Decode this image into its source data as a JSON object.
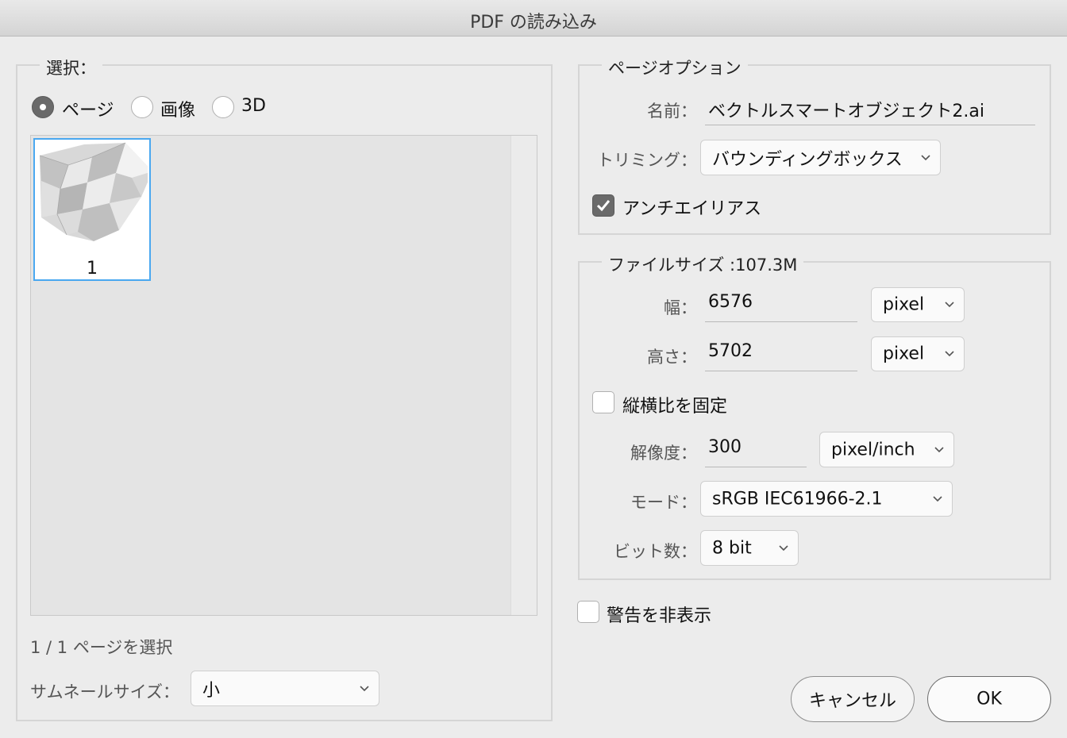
{
  "window": {
    "title": "PDF の読み込み"
  },
  "selection": {
    "legend": "選択：",
    "options": [
      "ページ",
      "画像",
      "3D"
    ],
    "selected": "ページ",
    "thumbnail_number": "1",
    "status": "1 / 1 ページを選択",
    "thumb_size_label": "サムネールサイズ：",
    "thumb_size_value": "小"
  },
  "page_options": {
    "legend": "ページオプション",
    "name_label": "名前：",
    "name_value": "ベクトルスマートオブジェクト2.ai",
    "crop_label": "トリミング：",
    "crop_value": "バウンディングボックス",
    "antialias_label": "アンチエイリアス",
    "antialias_checked": true
  },
  "image_size": {
    "legend": "ファイルサイズ :107.3M",
    "width_label": "幅：",
    "width_value": "6576",
    "width_unit": "pixel",
    "height_label": "高さ：",
    "height_value": "5702",
    "height_unit": "pixel",
    "constrain_label": "縦横比を固定",
    "constrain_checked": false,
    "resolution_label": "解像度：",
    "resolution_value": "300",
    "resolution_unit": "pixel/inch",
    "mode_label": "モード：",
    "mode_value": "sRGB IEC61966-2.1",
    "depth_label": "ビット数：",
    "depth_value": "8 bit"
  },
  "suppress_warnings": {
    "label": "警告を非表示",
    "checked": false
  },
  "buttons": {
    "cancel": "キャンセル",
    "ok": "OK"
  },
  "colors": {
    "thumb_selected_border": "#4aa8f0",
    "checked_fill": "#6a6a6a"
  }
}
